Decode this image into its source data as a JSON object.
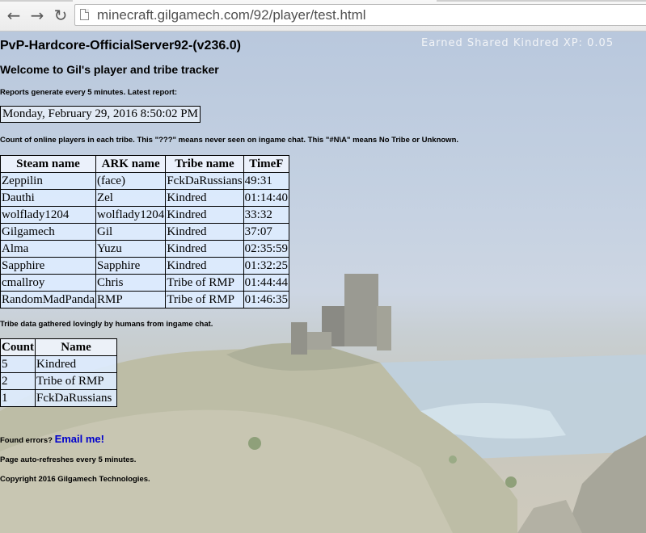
{
  "browser": {
    "url": "minecraft.gilgamech.com/92/player/test.html"
  },
  "page": {
    "xp_text": "Earned Shared Kindred XP: 0.05",
    "server_title": "PvP-Hardcore-OfficialServer92-(v236.0)",
    "welcome": "Welcome to Gil's player and tribe tracker",
    "reports_note": "Reports generate every 5 minutes. Latest report:",
    "report_time": "Monday, February 29, 2016 8:50:02 PM",
    "count_note": "Count of online players in each tribe. This \"???\" means never seen on ingame chat. This \"#N\\A\" means No Tribe or Unknown.",
    "players_table": {
      "headers": [
        "Steam name",
        "ARK name",
        "Tribe name",
        "TimeF"
      ],
      "rows": [
        [
          "Zeppilin",
          "(face)",
          "FckDaRussians",
          "49:31"
        ],
        [
          "Dauthi",
          "Zel",
          "Kindred",
          "01:14:40"
        ],
        [
          "wolflady1204",
          "wolflady1204",
          "Kindred",
          "33:32"
        ],
        [
          "Gilgamech",
          "Gil",
          "Kindred",
          "37:07"
        ],
        [
          "Alma",
          "Yuzu",
          "Kindred",
          "02:35:59"
        ],
        [
          "Sapphire",
          "Sapphire",
          "Kindred",
          "01:32:25"
        ],
        [
          "cmallroy",
          "Chris",
          "Tribe of RMP",
          "01:44:44"
        ],
        [
          "RandomMadPanda",
          "RMP",
          "Tribe of RMP",
          "01:46:35"
        ]
      ]
    },
    "tribe_note": "Tribe data gathered lovingly by humans from ingame chat.",
    "tribe_table": {
      "headers": [
        "Count",
        "Name"
      ],
      "rows": [
        [
          "5",
          "Kindred"
        ],
        [
          "2",
          "Tribe of RMP"
        ],
        [
          "1",
          "FckDaRussians"
        ]
      ]
    },
    "errors_text": "Found errors?",
    "email_link": "Email me!",
    "refresh_note": "Page auto-refreshes every 5 minutes.",
    "copyright": "Copyright 2016 Gilgamech Technologies."
  }
}
